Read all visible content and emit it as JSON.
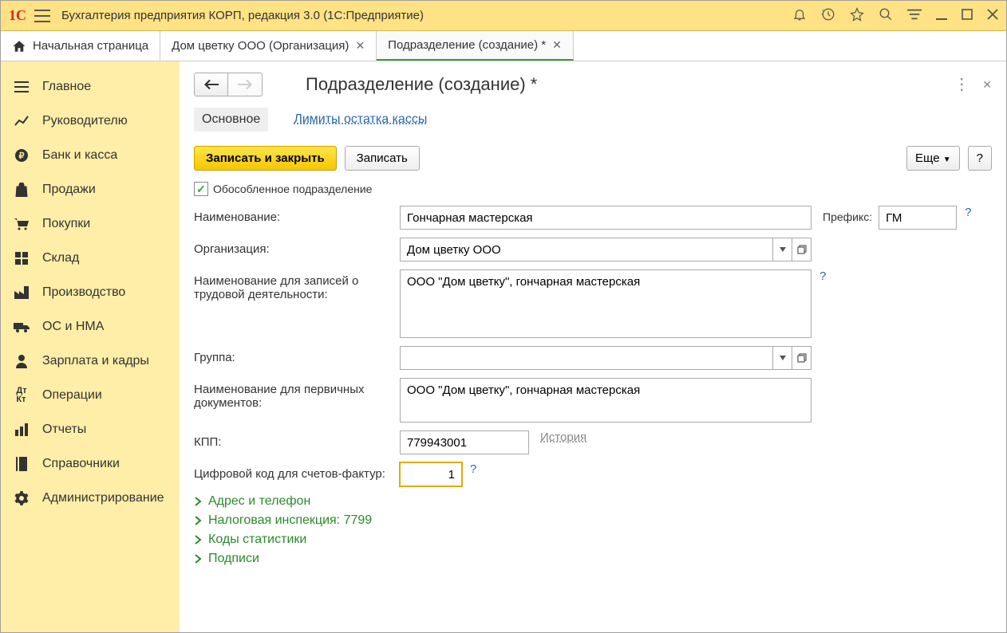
{
  "titlebar": {
    "app_title": "Бухгалтерия предприятия КОРП, редакция 3.0  (1С:Предприятие)"
  },
  "tabs": {
    "home": "Начальная страница",
    "t1": "Дом цветку ООО (Организация)",
    "t2": "Подразделение (создание) *"
  },
  "sidebar": {
    "items": [
      {
        "label": "Главное"
      },
      {
        "label": "Руководителю"
      },
      {
        "label": "Банк и касса"
      },
      {
        "label": "Продажи"
      },
      {
        "label": "Покупки"
      },
      {
        "label": "Склад"
      },
      {
        "label": "Производство"
      },
      {
        "label": "ОС и НМА"
      },
      {
        "label": "Зарплата и кадры"
      },
      {
        "label": "Операции"
      },
      {
        "label": "Отчеты"
      },
      {
        "label": "Справочники"
      },
      {
        "label": "Администрирование"
      }
    ]
  },
  "main": {
    "title": "Подразделение (создание) *",
    "subtabs": {
      "main": "Основное",
      "limits": "Лимиты остатка кассы"
    },
    "buttons": {
      "save_close": "Записать и закрыть",
      "save": "Записать",
      "more": "Еще",
      "help": "?"
    },
    "checkbox_label": "Обособленное подразделение",
    "labels": {
      "name": "Наименование:",
      "prefix": "Префикс:",
      "org": "Организация:",
      "labor_name": "Наименование для записей о трудовой деятельности:",
      "group": "Группа:",
      "doc_name": "Наименование для первичных документов:",
      "kpp": "КПП:",
      "history": "История",
      "digit_code": "Цифровой код для счетов-фактур:"
    },
    "values": {
      "name": "Гончарная мастерская",
      "prefix": "ГМ",
      "org": "Дом цветку ООО",
      "labor_name": "ООО \"Дом цветку\", гончарная мастерская",
      "group": "",
      "doc_name": "ООО \"Дом цветку\", гончарная мастерская",
      "kpp": "779943001",
      "digit_code": "1"
    },
    "expands": {
      "address": "Адрес и телефон",
      "tax": "Налоговая инспекция: 7799",
      "stat": "Коды статистики",
      "sign": "Подписи"
    }
  }
}
